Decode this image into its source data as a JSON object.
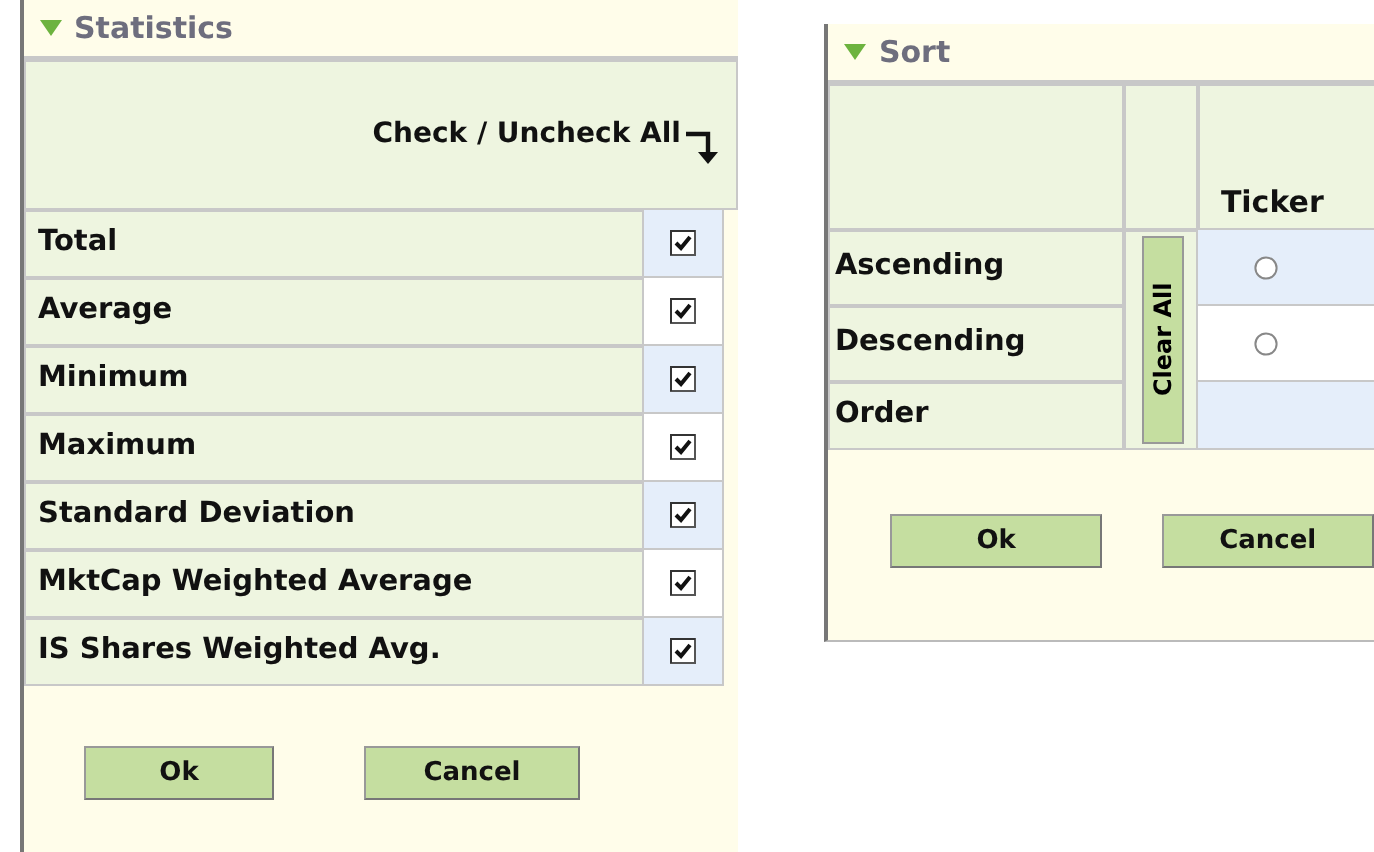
{
  "statistics": {
    "title": "Statistics",
    "expanded": true,
    "check_all_label": "Check / Uncheck All",
    "items": [
      {
        "label": "Total",
        "checked": true
      },
      {
        "label": "Average",
        "checked": true
      },
      {
        "label": "Minimum",
        "checked": true
      },
      {
        "label": "Maximum",
        "checked": true
      },
      {
        "label": "Standard Deviation",
        "checked": true
      },
      {
        "label": "MktCap Weighted Average",
        "checked": true
      },
      {
        "label": "IS Shares Weighted Avg.",
        "checked": true
      }
    ],
    "buttons": [
      "Ok",
      "Cancel"
    ]
  },
  "sort": {
    "title": "Sort",
    "expanded": true,
    "clear_all_label": "Clear All",
    "column_header": "Ticker",
    "rows": [
      {
        "label": "Ascending",
        "kind": "radio",
        "selected": false
      },
      {
        "label": "Descending",
        "kind": "radio",
        "selected": false
      },
      {
        "label": "Order",
        "kind": "empty"
      }
    ],
    "buttons": [
      "Ok",
      "Cancel"
    ]
  }
}
